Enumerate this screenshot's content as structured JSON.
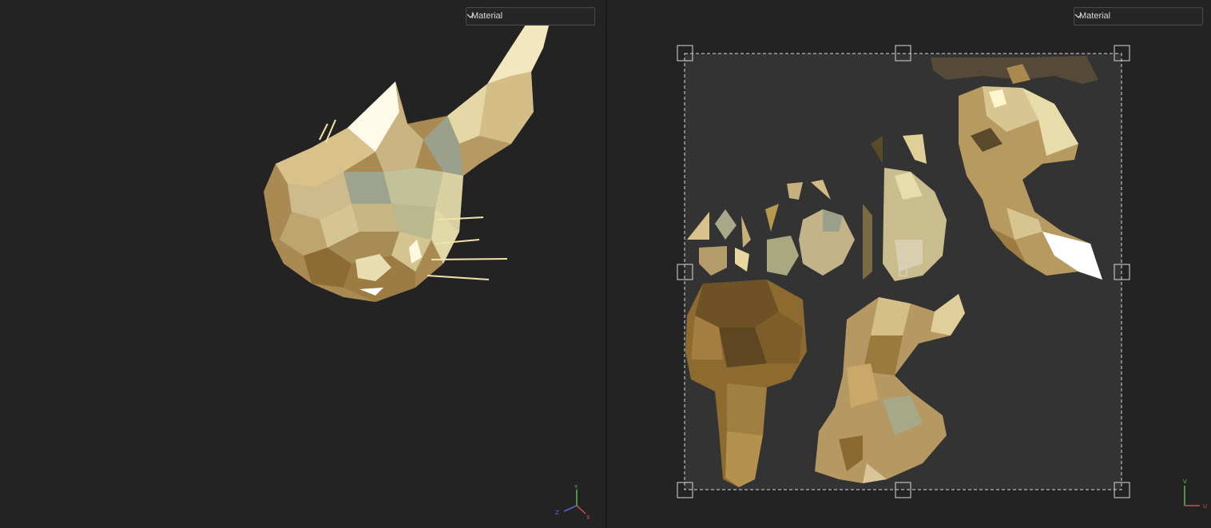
{
  "viewport_3d": {
    "shading_mode": "Material",
    "axes": {
      "y": "Y",
      "z": "Z",
      "x": "X"
    }
  },
  "viewport_uv": {
    "shading_mode": "Material",
    "axes": {
      "v": "V",
      "u": "U"
    }
  },
  "colors": {
    "background": "#232323",
    "uv_canvas": "#333333",
    "fur_light": "#d9c894",
    "fur_mid": "#b89a5c",
    "fur_dark": "#7a5a24",
    "axis_x": "#d05050",
    "axis_y": "#58b858",
    "axis_z": "#6a6ad8"
  }
}
